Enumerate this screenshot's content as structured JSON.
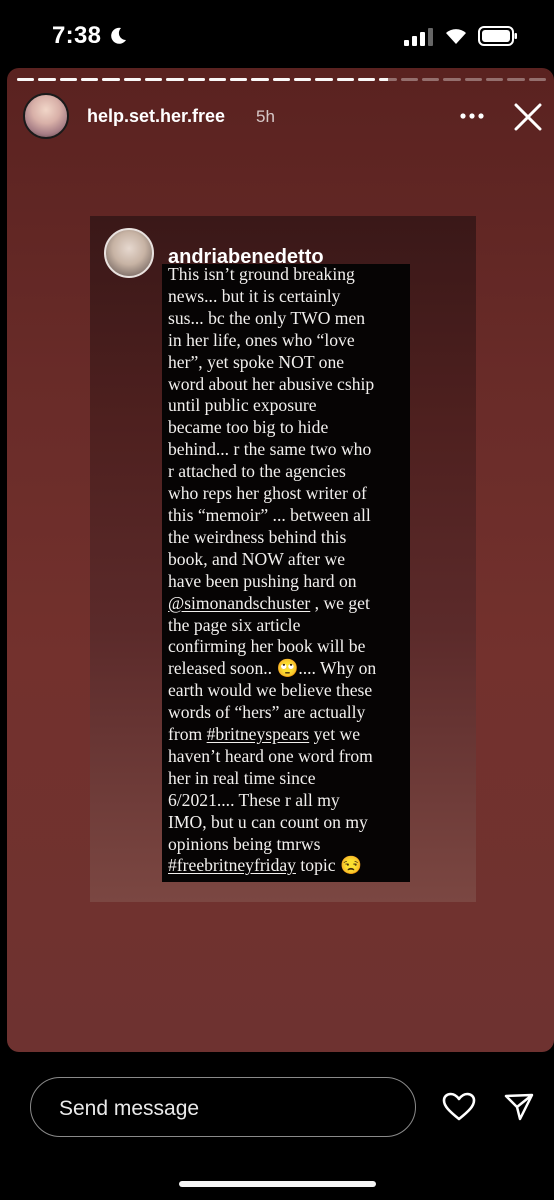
{
  "status_bar": {
    "time": "7:38"
  },
  "story": {
    "username": "help.set.her.free",
    "time_ago": "5h",
    "progress": [
      1,
      1,
      1,
      1,
      1,
      1,
      1,
      1,
      1,
      1,
      1,
      1,
      1,
      1,
      1,
      1,
      1,
      0.5,
      0,
      0,
      0,
      0,
      0,
      0,
      0
    ]
  },
  "embedded_post": {
    "username": "andriabenedetto",
    "lines": [
      "This isn’t ground breaking",
      "news... but it is certainly",
      "sus... bc the only TWO men",
      "in her life, ones who “love",
      "her”, yet spoke NOT one",
      "word about her abusive cship",
      "until public exposure",
      "became too big to hide",
      "behind... r the same two who",
      "r attached to the agencies",
      "who reps her ghost writer of",
      "this “memoir” ... between all",
      "the weirdness behind this",
      "book, and NOW after we",
      "have been pushing hard on",
      "@simonandschuster , we get",
      "the page six article",
      "confirming her book will be",
      "released soon.. 🙄.... Why on",
      "earth would we believe these",
      "words of “hers” are actually",
      "from #britneyspears yet we",
      "haven’t heard one word from",
      "her in real time since",
      "6/2021.... These r all my",
      "IMO, but u can count on my",
      "opinions being tmrws",
      "#freebritneyfriday topic 😒"
    ]
  },
  "footer": {
    "message_placeholder": "Send message"
  }
}
